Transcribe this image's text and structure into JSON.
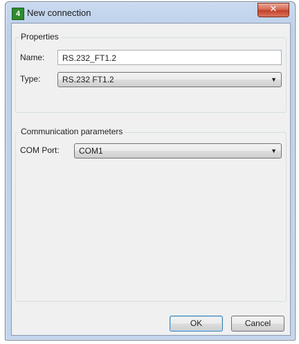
{
  "window": {
    "title": "New connection",
    "icon": "app-4-icon",
    "close_glyph": "✕"
  },
  "properties": {
    "group_label": "Properties",
    "name_label": "Name:",
    "name_value": "RS.232_FT1.2",
    "type_label": "Type:",
    "type_value": "RS.232 FT1.2"
  },
  "communication": {
    "group_label": "Communication parameters",
    "com_port_label": "COM Port:",
    "com_port_value": "COM1"
  },
  "buttons": {
    "ok": "OK",
    "cancel": "Cancel"
  },
  "icons": {
    "dropdown": "▼"
  }
}
